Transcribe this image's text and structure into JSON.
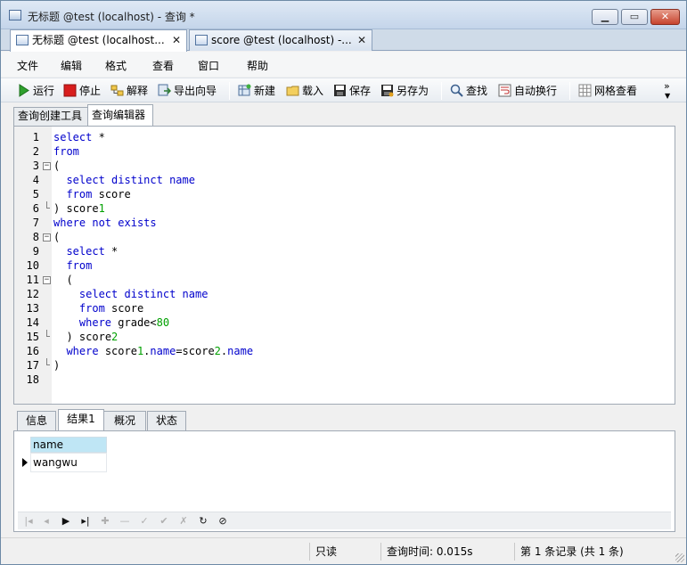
{
  "window": {
    "title": "无标题 @test (localhost) - 查询 *"
  },
  "doc_tabs": [
    {
      "label": "无标题 @test (localhost...",
      "close": "✕"
    },
    {
      "label": "score @test (localhost) -...",
      "close": "✕"
    }
  ],
  "menu": [
    "文件",
    "编辑",
    "格式",
    "查看",
    "窗口",
    "帮助"
  ],
  "toolbar": {
    "run": "运行",
    "stop": "停止",
    "explain": "解释",
    "export": "导出向导",
    "new": "新建",
    "load": "载入",
    "save": "保存",
    "save_as": "另存为",
    "find": "查找",
    "wrap": "自动换行",
    "grid_view": "网格查看",
    "more": "»"
  },
  "inner_tabs": [
    "查询创建工具",
    "查询编辑器"
  ],
  "code_lines": [
    "select *",
    "from",
    "(",
    "  select distinct name",
    "  from score",
    ") score1",
    "where not exists",
    "(",
    "  select *",
    "  from",
    "  (",
    "    select distinct name",
    "    from score",
    "    where grade<80",
    "  ) score2",
    "  where score1.name=score2.name",
    ")",
    ""
  ],
  "line_numbers": [
    "1",
    "2",
    "3",
    "4",
    "5",
    "6",
    "7",
    "8",
    "9",
    "10",
    "11",
    "12",
    "13",
    "14",
    "15",
    "16",
    "17",
    "18"
  ],
  "result_tabs": [
    "信息",
    "结果1",
    "概况",
    "状态"
  ],
  "result": {
    "column": "name",
    "rows": [
      "wangwu"
    ]
  },
  "status": {
    "readonly": "只读",
    "query_time": "查询时间: 0.015s",
    "records": "第 1 条记录 (共 1 条)"
  }
}
